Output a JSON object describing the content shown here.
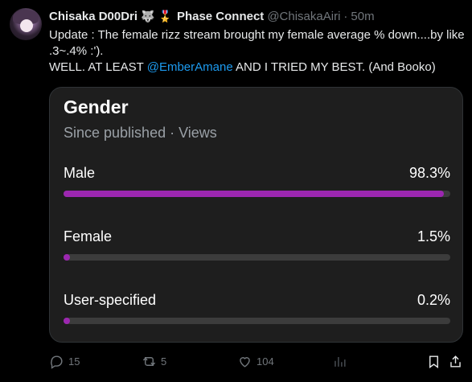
{
  "author": {
    "name": "Chisaka D00Dri",
    "badges": [
      "🐺",
      "🎖️"
    ],
    "group": "Phase Connect",
    "handle": "@ChisakaAiri",
    "separator": "·",
    "time": "50m"
  },
  "tweet": {
    "line1": "Update : The female rizz stream brought my female average % down....by like .3~.4% :').",
    "line2_before": "WELL. AT LEAST ",
    "mention": "@EmberAmane",
    "line2_after": " AND I TRIED MY BEST. (And Booko)"
  },
  "card": {
    "title": "Gender",
    "subtitle": "Since published · Views",
    "rows": [
      {
        "label": "Male",
        "value_text": "98.3%",
        "percent": 98.3
      },
      {
        "label": "Female",
        "value_text": "1.5%",
        "percent": 1.5
      },
      {
        "label": "User-specified",
        "value_text": "0.2%",
        "percent": 0.2
      }
    ],
    "bar_color": "#9c27b0",
    "track_color": "#3c3c3c"
  },
  "actions": {
    "reply_count": "15",
    "repost_count": "5",
    "like_count": "104",
    "icons": [
      "reply-icon",
      "repost-icon",
      "like-icon",
      "views-icon",
      "bookmark-icon",
      "share-icon"
    ]
  },
  "colors": {
    "background": "#000000",
    "text": "#e7e9ea",
    "muted": "#71767b",
    "link": "#1d9bf0"
  }
}
